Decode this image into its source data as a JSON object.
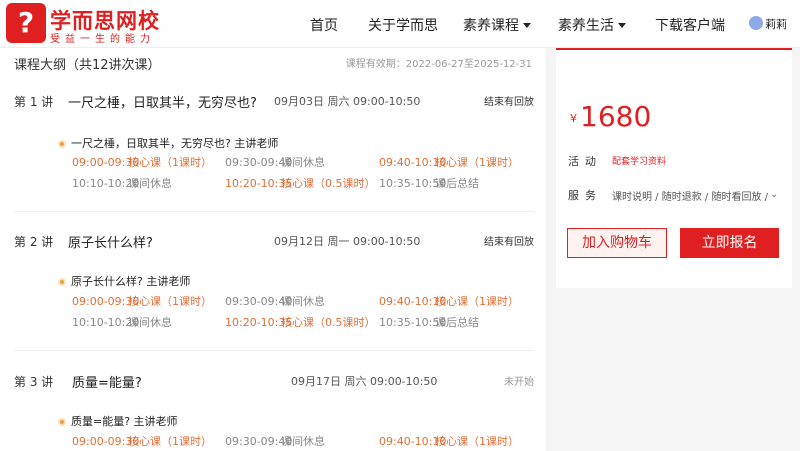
{
  "header": {
    "logo_name": "学而思网校",
    "logo_slogan": "受益一生的能力",
    "nav": [
      "首页",
      "关于学而思",
      "素养课程",
      "素养生活",
      "下载客户端"
    ],
    "username": "莉莉"
  },
  "outline": {
    "title": "课程大纲（共12讲次课）",
    "validity": "课程有效期：2022-06-27至2025-12-31"
  },
  "lessons": [
    {
      "num": "第 1 讲",
      "title": "一尺之棰，日取其半，无穷尽也?",
      "date": "09月03日 周六 09:00-10:50",
      "status": "结束有回放",
      "teacher": "一尺之棰，日取其半，无穷尽也?  主讲老师",
      "schedule": [
        {
          "time": "09:00-09:30",
          "desc": "核心课（1课时）"
        },
        {
          "time": "09:30-09:40",
          "desc": "课间休息"
        },
        {
          "time": "09:40-10:10",
          "desc": "核心课（1课时）"
        },
        {
          "time": "10:10-10:20",
          "desc": "课间休息"
        },
        {
          "time": "10:20-10:35",
          "desc": "核心课（0.5课时）"
        },
        {
          "time": "10:35-10:50",
          "desc": "课后总结"
        }
      ]
    },
    {
      "num": "第 2 讲",
      "title": "原子长什么样?",
      "date": "09月12日 周一 09:00-10:50",
      "status": "结束有回放",
      "teacher": "原子长什么样?  主讲老师",
      "schedule": [
        {
          "time": "09:00-09:30",
          "desc": "核心课（1课时）"
        },
        {
          "time": "09:30-09:40",
          "desc": "课间休息"
        },
        {
          "time": "09:40-10:10",
          "desc": "核心课（1课时）"
        },
        {
          "time": "10:10-10:20",
          "desc": "课间休息"
        },
        {
          "time": "10:20-10:35",
          "desc": "核心课（0.5课时）"
        },
        {
          "time": "10:35-10:50",
          "desc": "课后总结"
        }
      ]
    },
    {
      "num": "第 3 讲",
      "title": "质量=能量?",
      "date": "09月17日 周六 09:00-10:50",
      "status": "未开始",
      "teacher": "质量=能量?  主讲老师",
      "schedule": [
        {
          "time": "09:00-09:30",
          "desc": "核心课（1课时）"
        },
        {
          "time": "09:30-09:40",
          "desc": "课间休息"
        },
        {
          "time": "09:40-10:10",
          "desc": "核心课（1课时）"
        }
      ]
    }
  ],
  "sidebar": {
    "currency": "¥",
    "price": "1680",
    "activity_label": "活动",
    "activity_tag": "配套学习资料",
    "service_label": "服务",
    "service_text": "课时说明 / 随时退款 / 随时看回放 /",
    "add_cart": "加入购物车",
    "enroll": "立即报名"
  },
  "colors": {
    "brand": "#e02020",
    "core_session": "#e0703a",
    "rest_session": "#888888"
  }
}
